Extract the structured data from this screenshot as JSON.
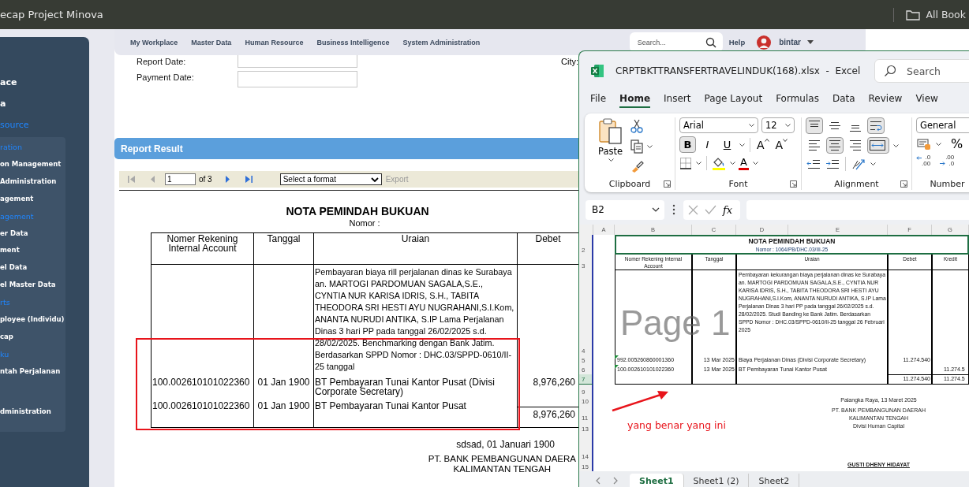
{
  "browser_bar": {
    "tab_title": "ecap Project Minova",
    "bookmarks_label": "All Book"
  },
  "sidebar": {
    "items": [
      {
        "label": "ace",
        "selected": false
      },
      {
        "label": "a",
        "selected": false
      },
      {
        "label": "source",
        "selected": true,
        "children": [
          {
            "label": "ration",
            "kind": "section"
          },
          {
            "label": "on Management",
            "kind": "link"
          },
          {
            "label": "Administration",
            "kind": "link"
          },
          {
            "label": "agement",
            "kind": "link"
          },
          {
            "label": "agement",
            "kind": "section"
          },
          {
            "label": "er Data",
            "kind": "link"
          },
          {
            "label": "ment",
            "kind": "link"
          },
          {
            "label": "el Data",
            "kind": "link"
          },
          {
            "label": "el Master Data",
            "kind": "link"
          },
          {
            "label": "rts",
            "kind": "section"
          },
          {
            "label": "ployee (Individu)",
            "kind": "link"
          },
          {
            "label": "cap",
            "kind": "link"
          },
          {
            "label": "ku",
            "kind": "section"
          },
          {
            "label": "ntah Perjalanan",
            "kind": "link"
          },
          {
            "label": "dministration",
            "kind": "link"
          }
        ]
      }
    ]
  },
  "nav": {
    "menu": [
      "My Workplace",
      "Master Data",
      "Human Resource",
      "Business Intelligence",
      "System Administration"
    ],
    "search": {
      "placeholder": "Search..."
    },
    "help": "Help",
    "user": "bintar"
  },
  "filters": {
    "fields": [
      {
        "label": "Report Date:"
      },
      {
        "label": "Payment Date:"
      }
    ],
    "city_label": "City:"
  },
  "report_panel": {
    "title": "Report Result",
    "toolbar": {
      "nav_buttons": [
        {
          "kind": "first",
          "disabled": true
        },
        {
          "kind": "prev",
          "disabled": true
        },
        {
          "kind": "next",
          "disabled": false
        },
        {
          "kind": "last",
          "disabled": false
        }
      ],
      "page": "1",
      "page_count": "of 3",
      "format": "Select a format",
      "export": {
        "label": "Export",
        "disabled": true
      }
    }
  },
  "report": {
    "title": "NOTA PEMINDAH BUKUAN",
    "subtitle": "Nomor :",
    "columns": [
      "Nomer Rekening Internal Account",
      "Tanggal",
      "Uraian",
      "Debet"
    ],
    "rows": [
      {
        "description": "Pembayaran biaya rill perjalanan dinas ke Surabaya an. MARTOGI PARDOMUAN SAGALA,S.E., CYNTIA NUR KARISA IDRIS, S.H., TABITA THEODORA SRI HESTI AYU NUGRAHANI,S.I.Kom, ANANTA NURUDI ANTIKA, S.IP Lama Perjalanan Dinas 3 hari PP pada tanggal 26/02/2025 s.d. 28/02/2025. Benchmarking dengan Bank Jatim. Berdasarkan SPPD Nomor : DHC.03/SPPD-0610/II-25 tanggal"
      },
      {
        "account": "100.002610101022360",
        "date": "01 Jan 1900",
        "description": "BT Pembayaran Tunai Kantor Pusat (Divisi Corporate Secretary)",
        "debet": "8,976,260"
      },
      {
        "account": "100.002610101022360",
        "date": "01 Jan 1900",
        "description": "BT Pembayaran Tunai Kantor Pusat"
      }
    ],
    "total_debet": "8,976,260",
    "place_date": "sdsad, 01 Januari 1900",
    "company": [
      "PT. BANK PEMBANGUNAN DAERA",
      "KALIMANTAN TENGAH"
    ]
  },
  "excel": {
    "title": "CRPTBKTTRANSFERTRAVELINDUK(168).xlsx  -  Excel",
    "search": {
      "placeholder": "Search"
    },
    "menu": [
      {
        "label": "File",
        "selected": false
      },
      {
        "label": "Home",
        "selected": true
      },
      {
        "label": "Insert",
        "selected": false
      },
      {
        "label": "Page Layout",
        "selected": false
      },
      {
        "label": "Formulas",
        "selected": false
      },
      {
        "label": "Data",
        "selected": false
      },
      {
        "label": "Review",
        "selected": false
      },
      {
        "label": "View",
        "selected": false
      }
    ],
    "ribbon": {
      "paste": "Paste",
      "font_name": "Arial",
      "font_size": "12",
      "font_buttons": [
        {
          "kind": "bold",
          "label": "B",
          "selected": true
        },
        {
          "kind": "italic",
          "label": "I",
          "selected": false
        },
        {
          "kind": "underline",
          "label": "U",
          "selected": false
        }
      ],
      "size_buttons": [
        {
          "kind": "grow",
          "label": "A"
        },
        {
          "kind": "shrink",
          "label": "A"
        }
      ],
      "font_color": "A",
      "align_buttons": [
        {
          "kind": "top",
          "selected": true
        },
        {
          "kind": "middle",
          "selected": false
        },
        {
          "kind": "bottom",
          "selected": false
        },
        {
          "kind": "wrap",
          "selected": true
        },
        {
          "kind": "left",
          "selected": false
        },
        {
          "kind": "center",
          "selected": true
        },
        {
          "kind": "right",
          "selected": false
        },
        {
          "kind": "merge",
          "selected": true
        }
      ],
      "number_format": "General",
      "percent": "%",
      "decimal_buttons": [
        {
          "kind": "increase",
          "labels": [
            ".0",
            ".00"
          ]
        },
        {
          "kind": "decrease",
          "labels": [
            ".00",
            ".0"
          ]
        }
      ],
      "groups": [
        "Clipboard",
        "Font",
        "Alignment",
        "Number"
      ]
    },
    "formula_bar": {
      "name_box": "B2",
      "fx": "fx"
    },
    "sheet": {
      "columns": [
        "A",
        "B",
        "C",
        "D",
        "E",
        "F",
        "G"
      ],
      "rows": [
        {
          "number": "2",
          "highlighted": false
        },
        {
          "number": "3",
          "highlighted": false
        },
        {
          "number": "4",
          "highlighted": false
        },
        {
          "number": "5",
          "highlighted": false
        },
        {
          "number": "6",
          "highlighted": false
        },
        {
          "number": "7",
          "highlighted": true
        },
        {
          "number": "9",
          "highlighted": false
        },
        {
          "number": "10",
          "highlighted": false
        },
        {
          "number": "11",
          "highlighted": false
        },
        {
          "number": "13",
          "highlighted": false
        },
        {
          "number": "14",
          "highlighted": false
        },
        {
          "number": "15",
          "highlighted": false
        }
      ],
      "page_label": "Page 1",
      "title": "NOTA PEMINDAH BUKUAN",
      "subtitle": "Nomor : 1064/PB/DHC.03/III-25",
      "table_columns": [
        "Nomer Rekening Internal Account",
        "Tanggal",
        "Uraian",
        "Debet",
        "Kredit"
      ],
      "description": "Pembayaran kekurangan biaya perjalanan dinas ke Surabaya an. MARTOGI PARDOMUAN SAGALA,S.E., CYNTIA NUR KARISA IDRIS, S.H., TABITA THEODORA SRI HESTI AYU NUGRAHANI,S.I.Kom, ANANTA NURUDI ANTIKA, S.IP Lama Perjalanan Dinas 3 hari PP pada tanggal 26/02/2025 s.d. 28/02/2025. Studi Banding ke Bank Jatim. Berdasarkan SPPD Nomor : DHC.03/SPPD-0610/II-25 tanggal 26 Februari 2025",
      "entries": [
        {
          "account": "992.005260860001360",
          "error_flag": true,
          "date": "13 Mar 2025",
          "description": "Biaya Perjalanan Dinas  (Divisi Corporate Secretary)",
          "debet": "11.274.540"
        },
        {
          "account": "100.002610101022360",
          "error_flag": true,
          "date": "13 Mar 2025",
          "description": "BT Pembayaran Tunai Kantor Pusat",
          "kredit": "11.274.5"
        }
      ],
      "total_debet": "11.274.540",
      "total_kredit": "11.274.5",
      "signature": {
        "place_date": "Palangka Raya, 13 Maret 2025",
        "company": [
          "PT. BANK PEMBANGUNAN DAERAH",
          "KALIMANTAN TENGAH"
        ],
        "division": "Divisi Human Capital",
        "signer": "GUSTI DHENY HIDAYAT"
      },
      "annotation": "yang benar yang ini"
    },
    "sheet_tabs": [
      {
        "label": "Sheet1",
        "selected": true
      },
      {
        "label": "Sheet1 (2)",
        "selected": false
      },
      {
        "label": "Sheet2",
        "selected": false
      }
    ]
  }
}
